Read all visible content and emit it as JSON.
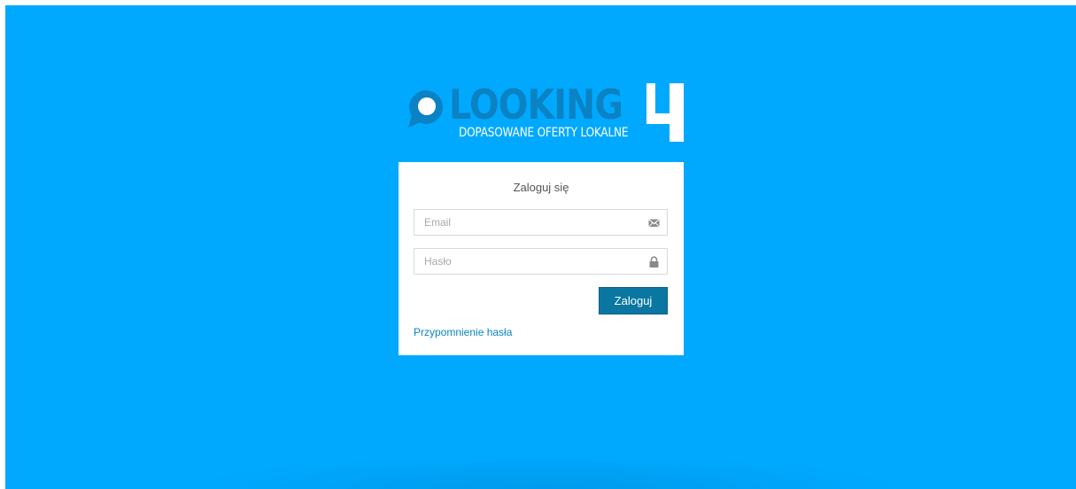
{
  "logo": {
    "wordmark": "LOOKING",
    "number": "4",
    "tagline": "DOPASOWANE OFERTY LOKALNE"
  },
  "login": {
    "title": "Zaloguj się",
    "email_placeholder": "Email",
    "password_placeholder": "Hasło",
    "submit_label": "Zaloguj",
    "forgot_password_label": "Przypomnienie hasła"
  },
  "icons": {
    "email": "envelope-icon",
    "password": "lock-icon",
    "logo_pin": "map-pin-icon"
  },
  "colors": {
    "background": "#00a9fe",
    "card": "#ffffff",
    "button": "#0a77a3",
    "link": "#0a86c0",
    "logo_blue": "#0a82c4"
  }
}
